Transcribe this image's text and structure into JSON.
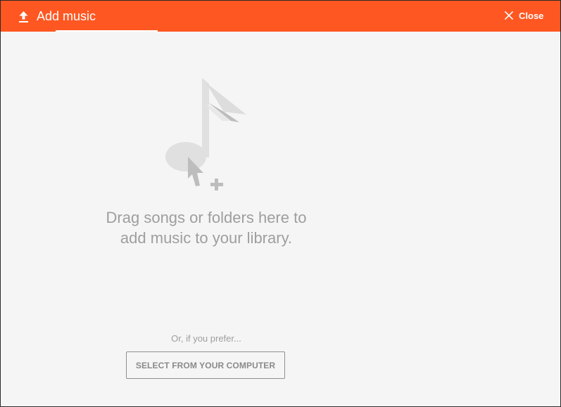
{
  "header": {
    "title": "Add music",
    "close_label": "Close",
    "upload_icon": "upload-icon",
    "close_icon": "close-icon",
    "accent_color": "#ff5722"
  },
  "main": {
    "illustration_icon": "music-note-add-cursor-icon",
    "drop_message_line1": "Drag songs or folders here to",
    "drop_message_line2": "add music to your library.",
    "prefer_text": "Or, if you prefer...",
    "select_button_label": "SELECT FROM YOUR COMPUTER"
  }
}
